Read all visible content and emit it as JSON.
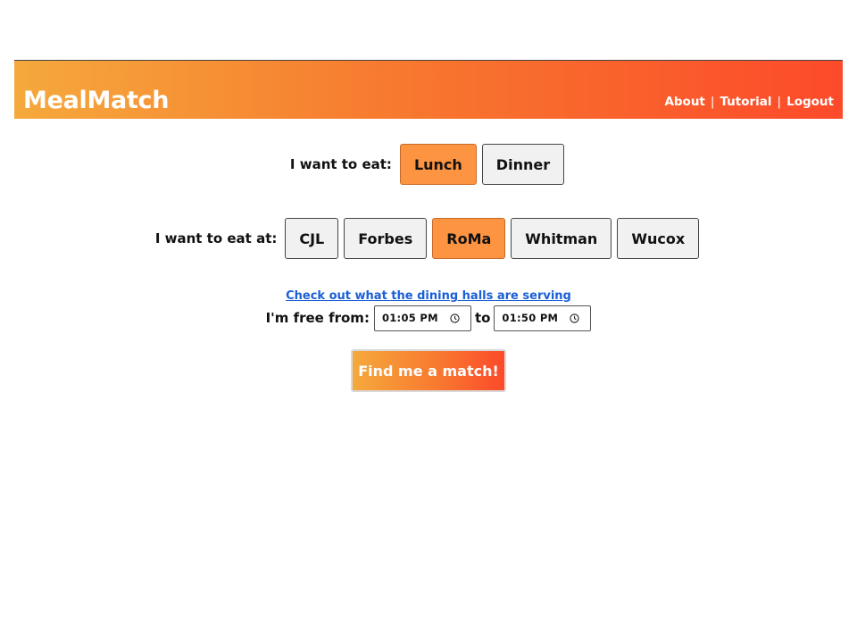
{
  "app": {
    "brand": "MealMatch"
  },
  "nav": {
    "links": [
      "About",
      "Tutorial",
      "Logout"
    ],
    "separator": "|"
  },
  "meal": {
    "label": "I want to eat:",
    "options": [
      "Lunch",
      "Dinner"
    ],
    "selected": "Lunch"
  },
  "hall": {
    "label": "I want to eat at:",
    "options": [
      "CJL",
      "Forbes",
      "RoMa",
      "Whitman",
      "Wucox"
    ],
    "selected": "RoMa"
  },
  "menu_link": "Check out what the dining halls are serving",
  "time": {
    "label": "I'm free from:",
    "from": "01:05 PM",
    "to_label": "to",
    "to": "01:50 PM"
  },
  "submit_label": "Find me a match!",
  "colors": {
    "accent": "#fd9441",
    "gradient_start": "#f5a93c",
    "gradient_end": "#fc4a2a",
    "link": "#1a5fd6"
  }
}
